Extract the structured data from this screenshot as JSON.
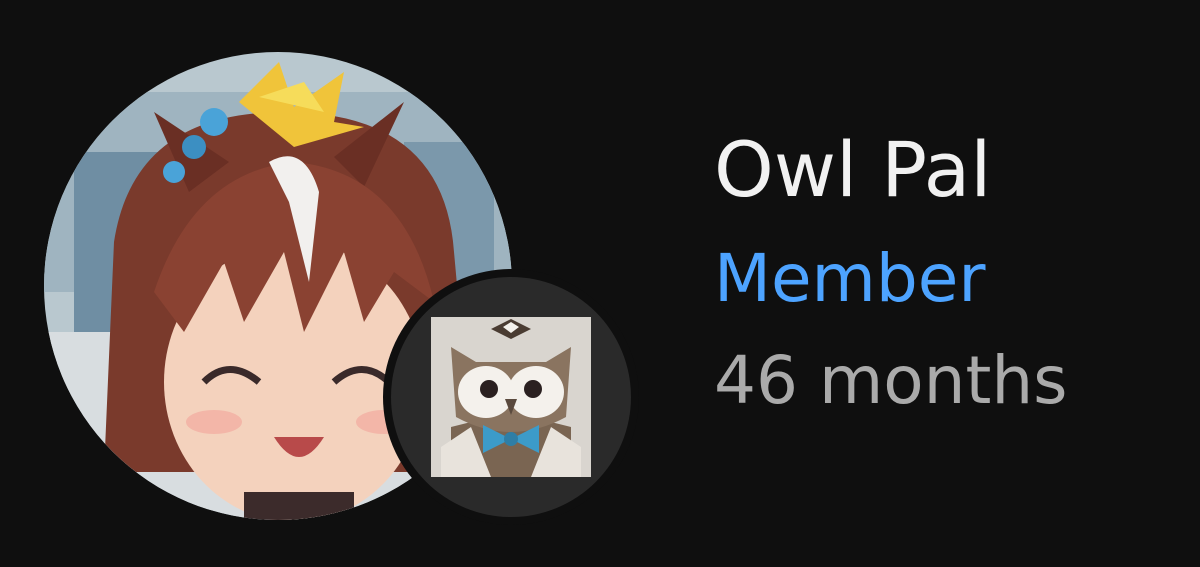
{
  "member": {
    "name": "Owl Pal",
    "tier_label": "Member",
    "tenure": "46 months"
  },
  "avatar": {
    "icon": "avatar-image",
    "badge_icon": "owl-badge-icon"
  },
  "colors": {
    "background": "#0f0f0f",
    "name": "#f1f1f1",
    "tier": "#4da3ff",
    "tenure": "#aaaaaa",
    "badge_bg": "#2a2a2a"
  }
}
